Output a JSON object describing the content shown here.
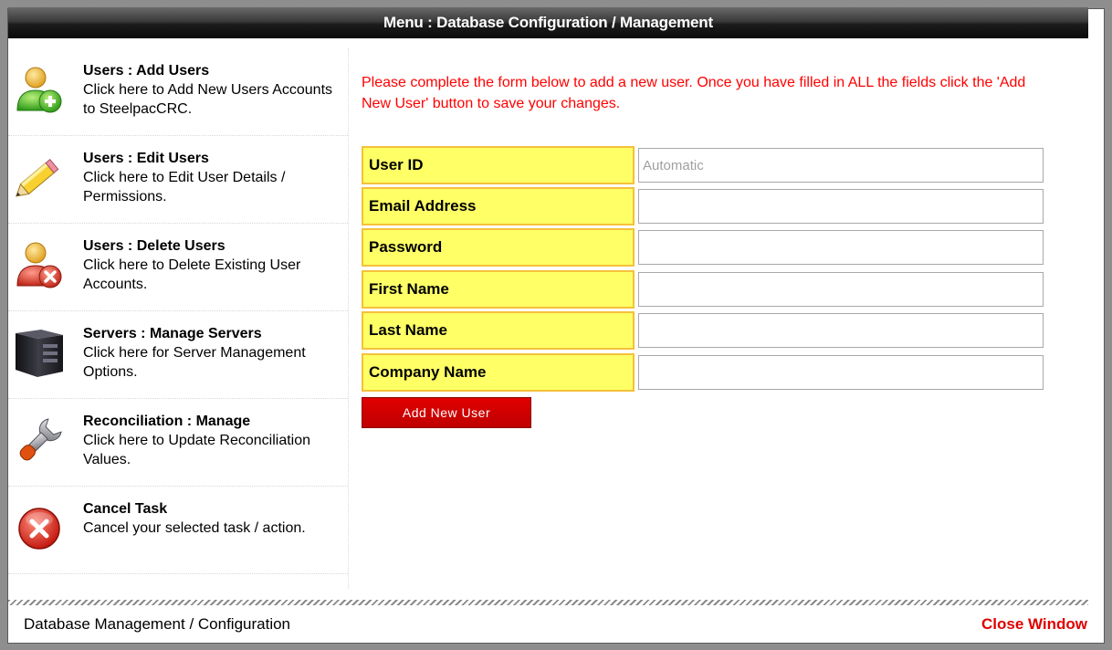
{
  "window": {
    "title": "Menu : Database Configuration / Management"
  },
  "sidebar": {
    "items": [
      {
        "icon": "user-add-icon",
        "title": "Users : Add Users",
        "desc": "Click here to Add New Users Accounts to SteelpacCRC."
      },
      {
        "icon": "pencil-icon",
        "title": "Users : Edit Users",
        "desc": "Click here to Edit User Details / Permissions."
      },
      {
        "icon": "user-delete-icon",
        "title": "Users : Delete Users",
        "desc": "Click here to Delete Existing User Accounts."
      },
      {
        "icon": "server-icon",
        "title": "Servers : Manage Servers",
        "desc": "Click here for Server Management Options."
      },
      {
        "icon": "wrench-icon",
        "title": "Reconciliation : Manage",
        "desc": "Click here to Update Reconciliation Values."
      },
      {
        "icon": "cancel-icon",
        "title": "Cancel Task",
        "desc": "Cancel your selected task / action."
      }
    ]
  },
  "form": {
    "notice": "Please complete the form below to add a new user. Once you have filled in ALL the fields click the 'Add New User' button to save your changes.",
    "fields": [
      {
        "label": "User ID",
        "value": "",
        "placeholder": "Automatic"
      },
      {
        "label": "Email Address",
        "value": "",
        "placeholder": ""
      },
      {
        "label": "Password",
        "value": "",
        "placeholder": ""
      },
      {
        "label": "First Name",
        "value": "",
        "placeholder": ""
      },
      {
        "label": "Last Name",
        "value": "",
        "placeholder": ""
      },
      {
        "label": "Company Name",
        "value": "",
        "placeholder": ""
      }
    ],
    "submit_label": "Add New User"
  },
  "footer": {
    "left_text": "Database Management / Configuration",
    "close_label": "Close Window"
  },
  "colors": {
    "accent_red": "#e00000",
    "label_yellow": "#ffff66",
    "label_border": "#f5c13a",
    "notice_red": "#ff0000"
  }
}
